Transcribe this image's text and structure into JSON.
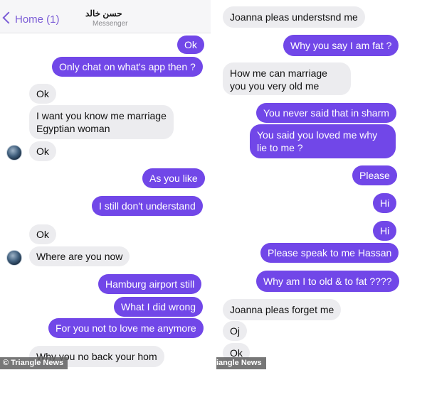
{
  "header": {
    "back_label": "Home (1)",
    "contact_name": "حسن خالد",
    "contact_sub": "Messenger"
  },
  "left_messages": [
    {
      "text": "Ok",
      "dir": "out"
    },
    {
      "text": "Only chat on what's app then ?",
      "dir": "out"
    },
    {
      "text": "Ok",
      "dir": "in"
    },
    {
      "text": "I want you know me marriage Egyptian woman",
      "dir": "in"
    },
    {
      "text": "Ok",
      "dir": "in"
    },
    {
      "text": "As you like",
      "dir": "out"
    },
    {
      "text": "I still don't understand",
      "dir": "out"
    },
    {
      "text": "Ok",
      "dir": "in"
    },
    {
      "text": "Where are you now",
      "dir": "in"
    },
    {
      "text": "Hamburg airport still",
      "dir": "out"
    },
    {
      "text": "What I did wrong",
      "dir": "out"
    },
    {
      "text": "For you not to love me anymore",
      "dir": "out"
    },
    {
      "text": "Why you no back your hom",
      "dir": "in"
    }
  ],
  "right_messages": [
    {
      "text": "Joanna pleas understsnd me",
      "dir": "in"
    },
    {
      "text": "Why you say I am fat ?",
      "dir": "out"
    },
    {
      "text": "How me can marriage you you very old me",
      "dir": "in"
    },
    {
      "text": "You never said that in sharm",
      "dir": "out"
    },
    {
      "text": "You said you loved me why lie to me ?",
      "dir": "out"
    },
    {
      "text": "Please",
      "dir": "out"
    },
    {
      "text": "Hi",
      "dir": "out"
    },
    {
      "text": "Hi",
      "dir": "out"
    },
    {
      "text": "Please speak to me Hassan",
      "dir": "out"
    },
    {
      "text": "Why am I to old & to fat ????",
      "dir": "out"
    },
    {
      "text": "Joanna pleas forget me",
      "dir": "in"
    },
    {
      "text": "Oj",
      "dir": "in"
    },
    {
      "text": "Ok",
      "dir": "in"
    }
  ],
  "watermark_left": "© Triangle News",
  "watermark_right": "iangle News",
  "colors": {
    "outgoing_bubble": "#7147e8",
    "incoming_bubble": "#ececef",
    "accent": "#7b5cd6"
  }
}
